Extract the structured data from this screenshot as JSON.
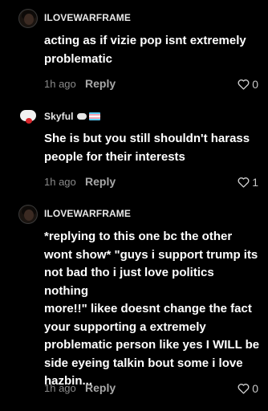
{
  "comments": [
    {
      "username": "ILOVEWARFRAME",
      "text": "acting as if vizie pop isnt extremely\nproblematic",
      "time": "1h ago",
      "reply_label": "Reply",
      "likes": "0",
      "avatar_icon": "dark-portrait-avatar"
    },
    {
      "username": "Skyful",
      "text": "She is but you still shouldn't harass\npeople for their interests",
      "time": "1h ago",
      "reply_label": "Reply",
      "likes": "1",
      "avatar_icon": "cloud-avatar"
    },
    {
      "username": "ILOVEWARFRAME",
      "text": "*replying to this one bc the other\nwont show* \"guys i support trump its\nnot bad tho i just love politics nothing\nmore!!\" likee doesnt change the fact\nyour supporting a extremely\nproblematic person like yes I WILL be\nside eyeing talkin bout some i love\nhazbin...",
      "time": "1h ago",
      "reply_label": "Reply",
      "likes": "0",
      "avatar_icon": "dark-portrait-avatar"
    }
  ],
  "colors": {
    "background": "#000000",
    "text": "#ffffff",
    "meta": "#8a8a8a"
  }
}
